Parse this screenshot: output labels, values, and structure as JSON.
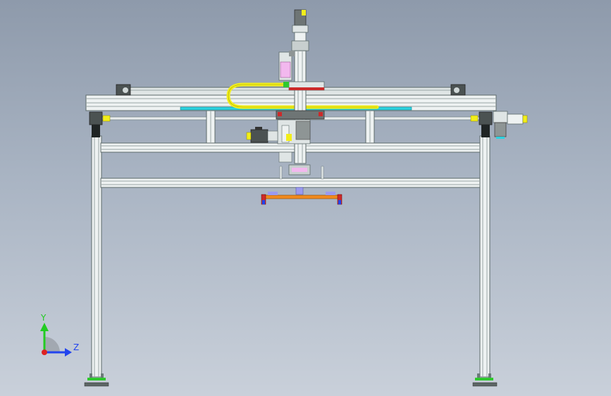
{
  "triad": {
    "y_label": "Y",
    "z_label": "Z",
    "y_color": "#22cc22",
    "z_color": "#2244ee",
    "x_color": "#dd2222"
  },
  "colors": {
    "frame": "#eef2f2",
    "frame_edge": "#5d6b6b",
    "energy_chain": "#f2ee1a",
    "guide_rail": "#2bd3e0",
    "carriage_red": "#cc2a2a",
    "gripper_orange": "#f08a1e"
  }
}
